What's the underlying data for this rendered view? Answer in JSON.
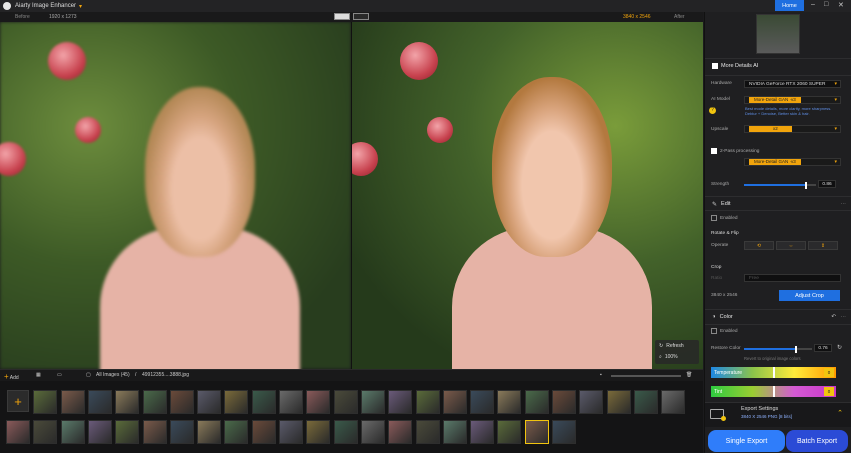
{
  "app": {
    "title": "Aiarty Image Enhancer",
    "home": "Home"
  },
  "window": {
    "minimize": "–",
    "maximize": "□",
    "close": "✕"
  },
  "sizes": {
    "before_label": "Before",
    "before": "1920 x 1273",
    "after": "3840 x 2546",
    "after_label": "After"
  },
  "preview": {
    "refresh": "Refresh",
    "zoom": "100%"
  },
  "thumbbar": {
    "add": "Add",
    "all_images": "All Images (45)",
    "separator": "/",
    "filename": "49912355....3888.jpg"
  },
  "panel": {
    "more_details": "More Details AI",
    "hardware_label": "Hardware",
    "hardware_value": "NVIDIA GeForce RTX 2060 SUPER",
    "ai_model_label": "AI Model",
    "ai_model_value": "More-Detail GAN ·v3",
    "ai_model_desc": "Best mode details, more clarity, more sharpness. Deblur + Denoise, Better skin & hair.",
    "upscale_label": "Upscale",
    "upscale_value": "x2",
    "two_pass_label": "2-Pass processing",
    "two_pass_value": "More-Detail GAN ·v3",
    "strength_label": "Strength",
    "strength_value": "0.86",
    "strength_level": 0.86,
    "edit_title": "Edit",
    "enabled_label": "Enabled",
    "rotate_label": "Rotate & Flip",
    "operate_label": "Operate",
    "crop_label": "Crop",
    "crop_ratio_label": "Ratio",
    "crop_ratio_value": "Free",
    "crop_size": "3840 x 2546",
    "adjust_crop": "Adjust Crop",
    "color_title": "Color",
    "color_enabled_label": "Enabled",
    "restore_color_label": "Restore Color",
    "restore_color_value": "0.76",
    "restore_color_level": 0.76,
    "restore_hint": "Revert to original image colors",
    "temperature_label": "Temperature",
    "temperature_value": "0",
    "tint_label": "Tint",
    "tint_value": "0",
    "export_settings_title": "Export Settings",
    "export_settings_detail": "3840 X 2546  PNG  [8 bits]",
    "single_export": "Single Export",
    "batch_export": "Batch Export"
  },
  "colors": {
    "accent": "#1f6fe0",
    "highlight": "#f1a40c",
    "panel_bg": "#1f1f21"
  }
}
